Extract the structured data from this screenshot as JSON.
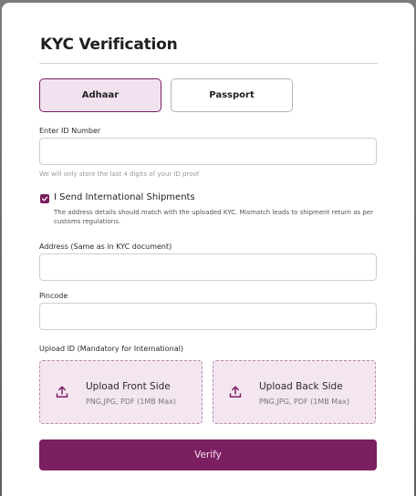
{
  "modal": {
    "title": "KYC Verification"
  },
  "tabs": {
    "aadhaar": "Adhaar",
    "passport": "Passport",
    "selected": "Adhaar"
  },
  "id_field": {
    "label": "Enter ID Number",
    "value": "",
    "helper": "We will only store the last 4 digits of your ID proof"
  },
  "international": {
    "checked": true,
    "label": "I Send International Shipments",
    "description": "The address details should match with the uploaded KYC. Mismatch leads to shipment return as per customs regulations."
  },
  "address_field": {
    "label": "Address (Same as in KYC document)",
    "value": ""
  },
  "pincode_field": {
    "label": "Pincode",
    "value": ""
  },
  "upload": {
    "label": "Upload ID (Mandatory for International)",
    "front_title": "Upload Front Side",
    "back_title": "Upload Back Side",
    "formats": "PNG,JPG, PDF (1MB Max)",
    "icon": "upload-icon"
  },
  "actions": {
    "verify_label": "Verify"
  },
  "colors": {
    "accent": "#7c1f60",
    "accent_light": "#f2e2ef"
  }
}
